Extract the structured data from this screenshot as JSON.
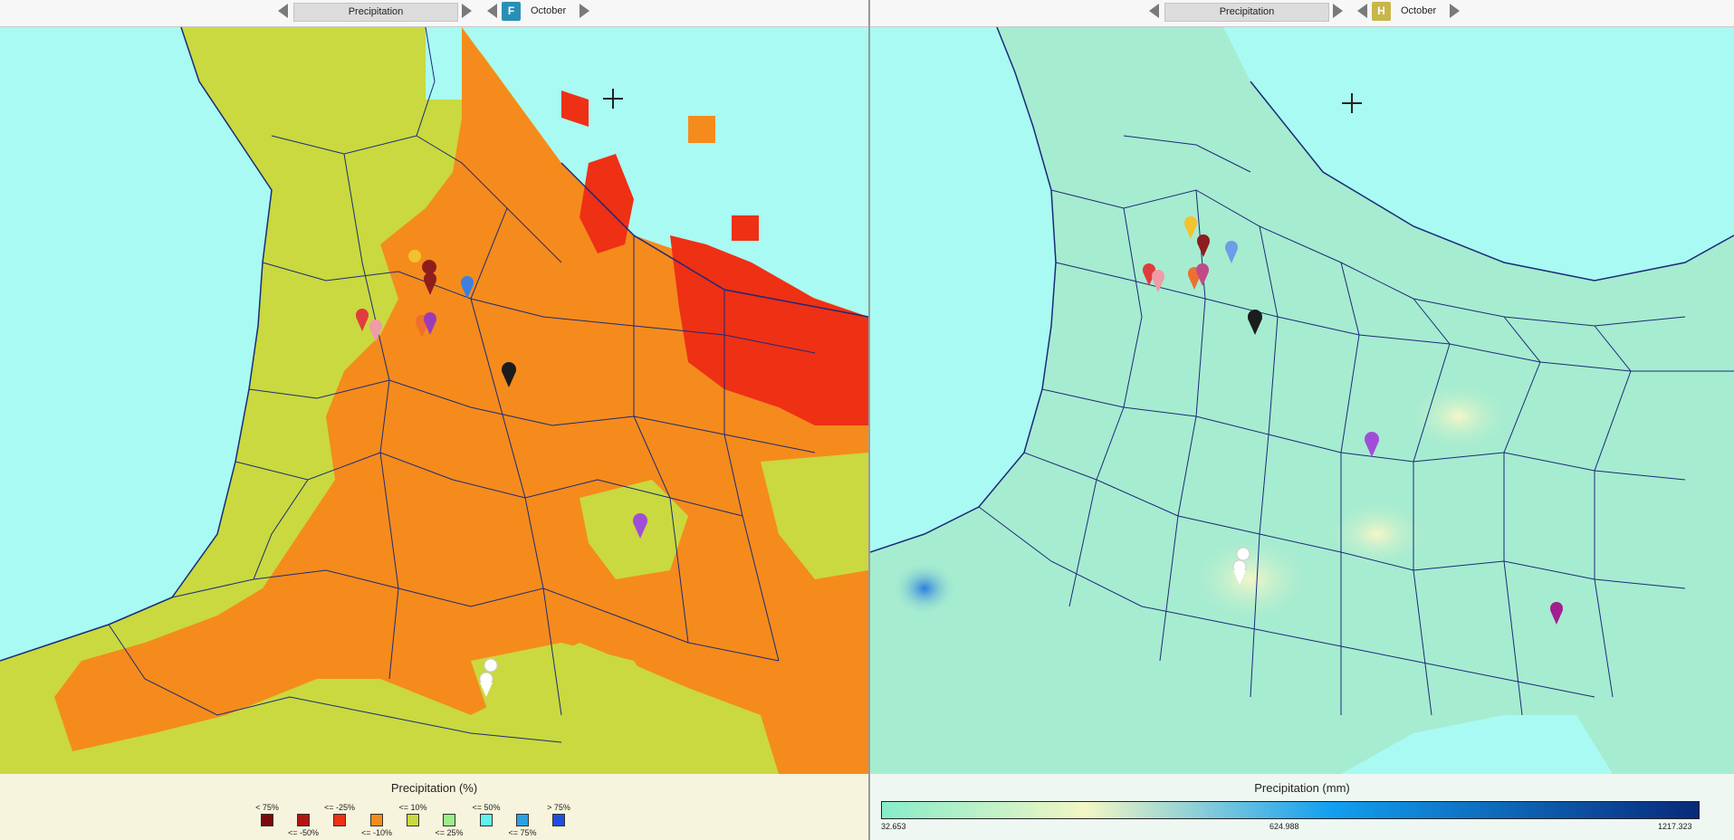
{
  "left_panel": {
    "toolbar": {
      "variable": "Precipitation",
      "badge": "F",
      "badge_color": "#2a8fb6",
      "month": "October"
    },
    "legend": {
      "title": "Precipitation (%)",
      "items": [
        {
          "label": "< 75%",
          "color": "#7a0a0a"
        },
        {
          "label": "<= -50%",
          "color": "#b31414"
        },
        {
          "label": "<= -25%",
          "color": "#ee3015"
        },
        {
          "label": "<= -10%",
          "color": "#f58b1c"
        },
        {
          "label": "<= 10%",
          "color": "#c9d93f"
        },
        {
          "label": "<= 25%",
          "color": "#9af088"
        },
        {
          "label": "<= 50%",
          "color": "#5ff2ec"
        },
        {
          "label": "<= 75%",
          "color": "#2aa0e6"
        },
        {
          "label": "> 75%",
          "color": "#1e4fe0"
        }
      ]
    }
  },
  "right_panel": {
    "toolbar": {
      "variable": "Precipitation",
      "badge": "H",
      "badge_color": "#c9b64a",
      "month": "October"
    },
    "legend": {
      "title": "Precipitation (mm)",
      "min": "32.653",
      "mid": "624.988",
      "max": "1217.323",
      "gradient": [
        "#88ecc9",
        "#f2f6c4",
        "#129ff0",
        "#09297a"
      ]
    }
  },
  "colors": {
    "sea": "#a9faf2",
    "left_land_green": "#c9d93f",
    "left_land_orange": "#f58b1c",
    "left_land_red": "#ee3015",
    "right_land": "#a6ecd0",
    "boundary": "#1b2a7a"
  },
  "marker_icons": [
    "map-pin-icon"
  ]
}
